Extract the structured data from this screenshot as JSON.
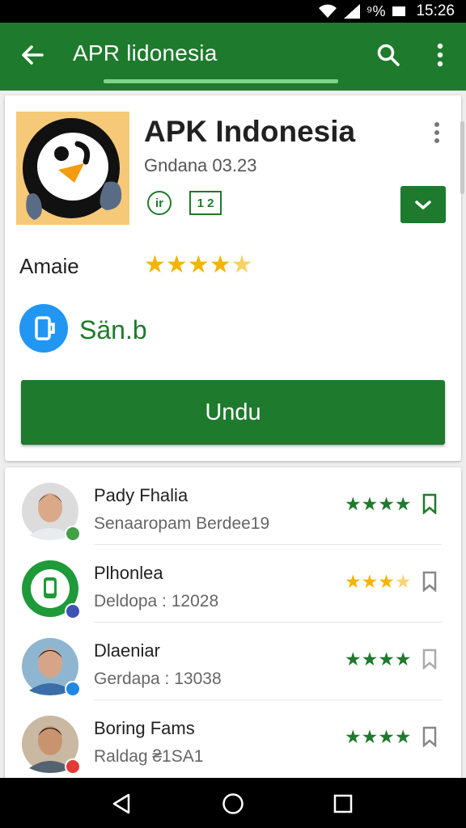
{
  "status_bar": {
    "signal_label": "⁹%",
    "time": "15:26"
  },
  "app_bar": {
    "title": "APR lidonesia"
  },
  "app": {
    "name": "APK Indonesia",
    "developer": "Gndana 03.23",
    "badge_1": "ir",
    "badge_2": "1 2",
    "rating_label": "Amaie",
    "rating_value": 4.5,
    "rating_max": 5,
    "safe_label": "Sän.b",
    "download_label": "Undu"
  },
  "reviews": [
    {
      "title": "Pady Fhalia",
      "subtitle": "Senaaropam Berdee19",
      "stars": 4,
      "star_color": "#1e7a2c",
      "mark_color": "#43a047"
    },
    {
      "title": "Plhonlea",
      "subtitle": "Deldopa : 12028",
      "stars": 3.5,
      "star_color": "#f4b400",
      "mark_color": "#3f51b5"
    },
    {
      "title": "Dlaeniar",
      "subtitle": "Gerdapa : 13038",
      "stars": 4,
      "star_color": "#1e7a2c",
      "mark_color": "#1e88e5"
    },
    {
      "title": "Boring Fams",
      "subtitle": "Raldag ₴1SA1",
      "stars": 4,
      "star_color": "#1e7a2c",
      "mark_color": "#e53935"
    }
  ],
  "colors": {
    "primary": "#1e7a2c",
    "accent_star": "#f4b400",
    "safe_blue": "#2196f3"
  }
}
